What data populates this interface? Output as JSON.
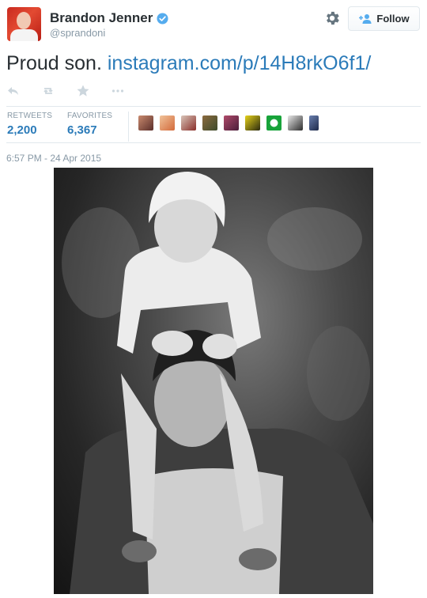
{
  "header": {
    "name": "Brandon Jenner",
    "handle": "@sprandoni",
    "follow_label": "Follow",
    "verified_icon": "verified-badge-icon",
    "settings_icon": "gear-icon"
  },
  "tweet": {
    "text": "Proud son. ",
    "link_text": "instagram.com/p/14H8rkO6f1/"
  },
  "actions": [
    "reply-icon",
    "retweet-icon",
    "favorite-icon",
    "more-icon"
  ],
  "stats": {
    "retweets_label": "RETWEETS",
    "retweets_count": "2,200",
    "favorites_label": "FAVORITES",
    "favorites_count": "6,367"
  },
  "favoriter_avatars": 9,
  "timestamp": "6:57 PM - 24 Apr 2015",
  "colors": {
    "link": "#2b7bb9",
    "muted": "#8899a6",
    "verified": "#55acee"
  }
}
